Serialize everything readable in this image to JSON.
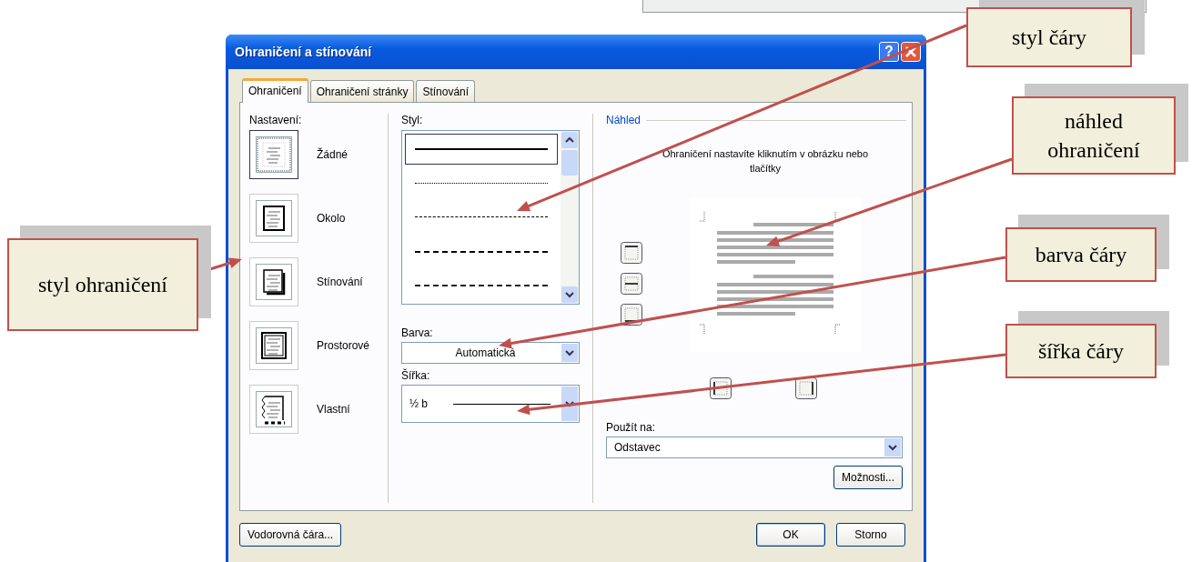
{
  "window": {
    "title": "Ohraničení a stínování",
    "help_button": "?"
  },
  "tabs": [
    {
      "label": "Ohraničení",
      "selected": true
    },
    {
      "label": "Ohraničení stránky",
      "selected": false
    },
    {
      "label": "Stínování",
      "selected": false
    }
  ],
  "settings": {
    "label": "Nastavení:",
    "items": [
      {
        "label": "Žádné",
        "kind": "none",
        "selected": true
      },
      {
        "label": "Okolo",
        "kind": "box",
        "selected": false
      },
      {
        "label": "Stínování",
        "kind": "shadow",
        "selected": false
      },
      {
        "label": "Prostorové",
        "kind": "threed",
        "selected": false
      },
      {
        "label": "Vlastní",
        "kind": "custom",
        "selected": false
      }
    ]
  },
  "style": {
    "label": "Styl:",
    "items": [
      {
        "kind": "solid",
        "selected": true
      },
      {
        "kind": "dotted",
        "selected": false
      },
      {
        "kind": "dashed",
        "selected": false
      },
      {
        "kind": "dashed-wide",
        "selected": false
      },
      {
        "kind": "dash-dot",
        "selected": false
      }
    ]
  },
  "color": {
    "label": "Barva:",
    "value": "Automatická"
  },
  "width": {
    "label": "Šířka:",
    "value": "½ b"
  },
  "preview": {
    "label": "Náhled",
    "hint": "Ohraničení nastavíte kliknutím v obrázku nebo tlačítky"
  },
  "apply_to": {
    "label": "Použít na:",
    "value": "Odstavec"
  },
  "options_button": "Možnosti...",
  "buttons": {
    "horizontal_line": "Vodorovná čára...",
    "ok": "OK",
    "cancel": "Storno"
  },
  "callouts": [
    {
      "text": "styl čáry"
    },
    {
      "text": "náhled ohraničení"
    },
    {
      "text": "barva čáry"
    },
    {
      "text": "šířka čáry"
    },
    {
      "text": "styl ohraničení"
    }
  ]
}
